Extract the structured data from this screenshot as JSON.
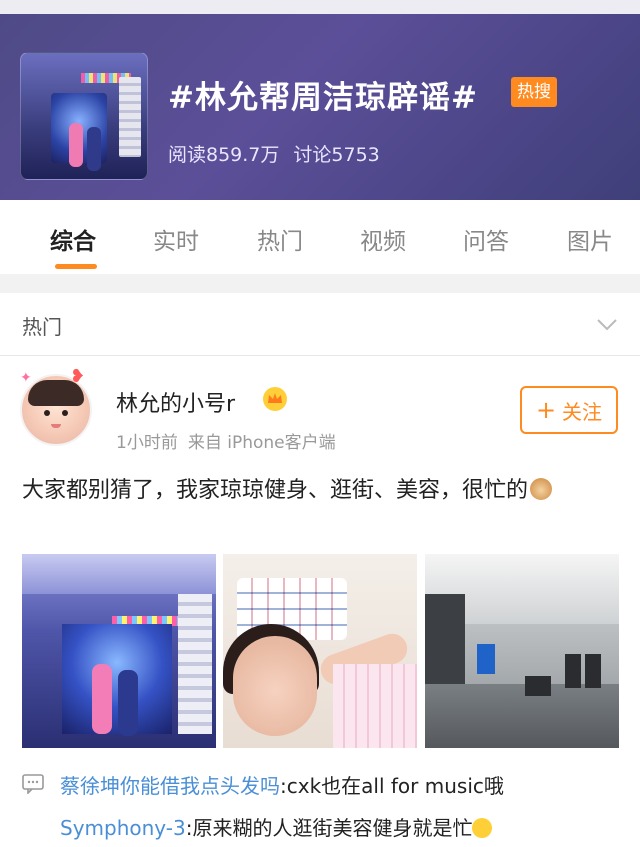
{
  "topic": {
    "title": "#林允帮周洁琼辟谣#",
    "badge": "热搜",
    "read": "阅读859.7万",
    "discuss": "讨论5753"
  },
  "tabs": [
    "综合",
    "实时",
    "热门",
    "视频",
    "问答",
    "图片"
  ],
  "active_tab": "综合",
  "section": {
    "label": "热门"
  },
  "post": {
    "username": "林允的小号r",
    "time": "1小时前",
    "source": "来自 iPhone客户端",
    "follow_label": "关注",
    "text": "大家都别猜了，我家琼琼健身、逛街、美容，很忙的",
    "images": [
      {
        "name": "store-photo"
      },
      {
        "name": "selfie-photo"
      },
      {
        "name": "gym-photo"
      }
    ],
    "comments": [
      {
        "name": "蔡徐坤你能借我点头发吗",
        "text": ":cxk也在all for music哦"
      },
      {
        "name": "Symphony-3",
        "text": ":原来糊的人逛街美容健身就是忙"
      }
    ]
  },
  "colors": {
    "accent": "#ff8a1f",
    "header": "#4e4a86",
    "link": "#4a8fd6"
  }
}
